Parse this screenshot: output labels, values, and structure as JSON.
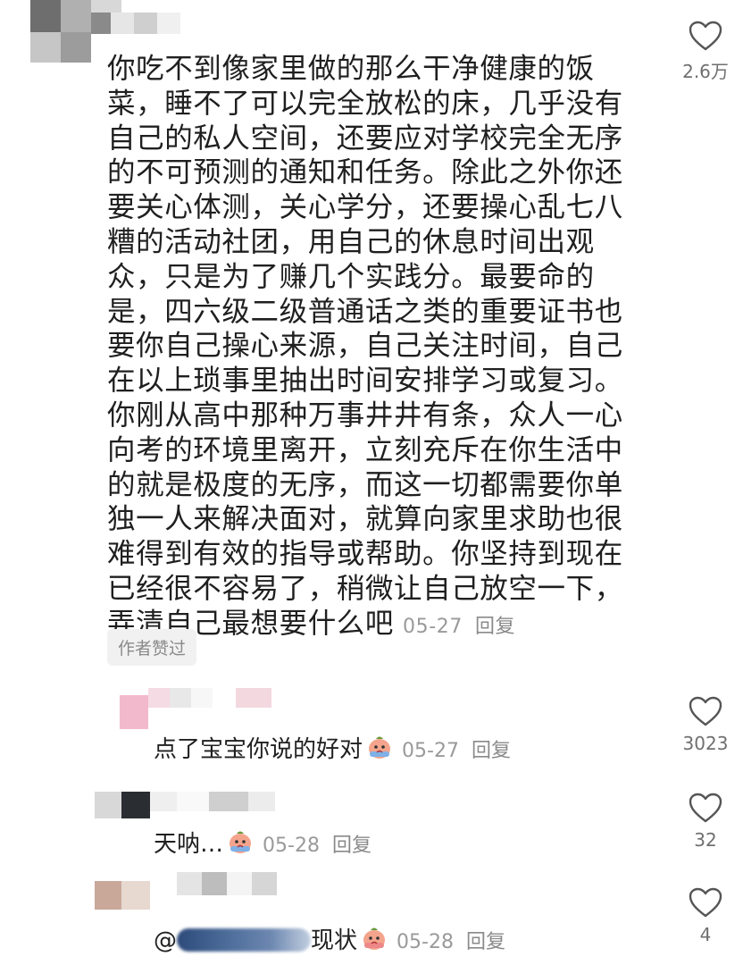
{
  "comments": [
    {
      "text": "你吃不到像家里做的那么干净健康的饭菜，睡不了可以完全放松的床，几乎没有自己的私人空间，还要应对学校完全无序的不可预测的通知和任务。除此之外你还要关心体测，关心学分，还要操心乱七八糟的活动社团，用自己的休息时间出观众，只是为了赚几个实践分。最要命的是，四六级二级普通话之类的重要证书也要你自己操心来源，自己关注时间，自己在以上琐事里抽出时间安排学习或复习。你刚从高中那种万事井井有条，众人一心向考的环境里离开，立刻充斥在你生活中的就是极度的无序，而这一切都需要你单独一人来解决面对，就算向家里求助也很难得到有效的指导或帮助。你坚持到现在已经很不容易了，稍微让自己放空一下，弄清自己最想要什么吧",
      "date": "05-27",
      "reply": "回复",
      "badge": "作者赞过",
      "likes": "2.6万"
    },
    {
      "text": "点了宝宝你说的好对",
      "emoji": "crying-face-emoji",
      "date": "05-27",
      "reply": "回复",
      "likes": "3023"
    },
    {
      "text": "天呐…",
      "emoji": "crying-face-emoji",
      "date": "05-28",
      "reply": "回复",
      "likes": "32"
    },
    {
      "mention": "@",
      "text": "现状",
      "emoji": "crying-face-emoji",
      "date": "05-28",
      "reply": "回复",
      "likes": "4"
    }
  ]
}
